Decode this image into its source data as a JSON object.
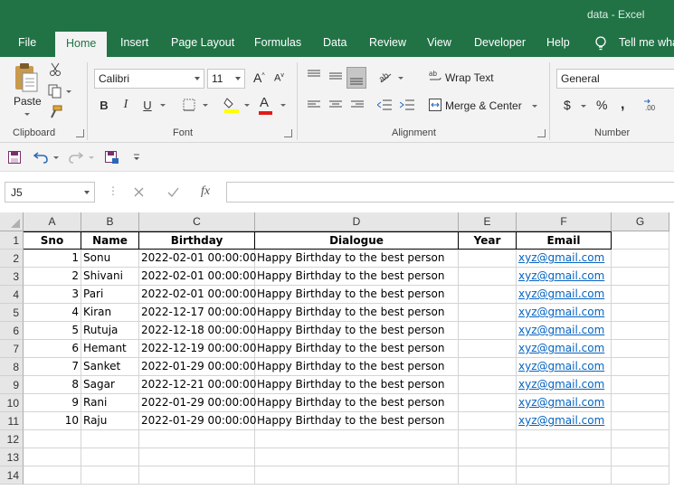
{
  "title": "data  -  Excel",
  "tabs": [
    "File",
    "Home",
    "Insert",
    "Page Layout",
    "Formulas",
    "Data",
    "Review",
    "View",
    "Developer",
    "Help",
    "Tell me wha"
  ],
  "active_tab": "Home",
  "ribbon": {
    "clipboard": {
      "paste_label": "Paste",
      "group_label": "Clipboard"
    },
    "font": {
      "name": "Calibri",
      "size": "11",
      "bold": "B",
      "italic": "I",
      "underline": "U",
      "color_glyph": "A",
      "group_label": "Font"
    },
    "alignment": {
      "wrap_text": "Wrap Text",
      "merge_center": "Merge & Center",
      "group_label": "Alignment"
    },
    "number": {
      "format": "General",
      "currency": "$",
      "percent": "%",
      "group_label": "Number"
    }
  },
  "formula_bar": {
    "name_box": "J5",
    "fx": "fx",
    "formula": ""
  },
  "sheet": {
    "columns": [
      "A",
      "B",
      "C",
      "D",
      "E",
      "F",
      "G"
    ],
    "row_numbers": [
      "1",
      "2",
      "3",
      "4",
      "5",
      "6",
      "7",
      "8",
      "9",
      "10",
      "11",
      "12",
      "13",
      "14"
    ],
    "headers": [
      "Sno",
      "Name",
      "Birthday",
      "Dialogue",
      "Year",
      "Email"
    ],
    "rows": [
      [
        "1",
        "Sonu",
        "2022-02-01 00:00:00",
        "Happy Birthday to the best person",
        "",
        "xyz@gmail.com"
      ],
      [
        "2",
        "Shivani",
        "2022-02-01 00:00:00",
        "Happy Birthday to the best person",
        "",
        "xyz@gmail.com"
      ],
      [
        "3",
        "Pari",
        "2022-02-01 00:00:00",
        "Happy Birthday to the best person",
        "",
        "xyz@gmail.com"
      ],
      [
        "4",
        "Kiran",
        "2022-12-17 00:00:00",
        "Happy Birthday to the best person",
        "",
        "xyz@gmail.com"
      ],
      [
        "5",
        "Rutuja",
        "2022-12-18 00:00:00",
        "Happy Birthday to the best person",
        "",
        "xyz@gmail.com"
      ],
      [
        "6",
        "Hemant",
        "2022-12-19 00:00:00",
        "Happy Birthday to the best person",
        "",
        "xyz@gmail.com"
      ],
      [
        "7",
        "Sanket",
        "2022-01-29 00:00:00",
        "Happy Birthday to the best person",
        "",
        "xyz@gmail.com"
      ],
      [
        "8",
        "Sagar",
        "2022-12-21 00:00:00",
        "Happy Birthday to the best person",
        "",
        "xyz@gmail.com"
      ],
      [
        "9",
        "Rani",
        "2022-01-29 00:00:00",
        "Happy Birthday to the best person",
        "",
        "xyz@gmail.com"
      ],
      [
        "10",
        "Raju",
        "2022-01-29 00:00:00",
        "Happy Birthday to the best person",
        "",
        "xyz@gmail.com"
      ]
    ]
  },
  "colors": {
    "brand": "#217346",
    "link": "#0563c1"
  }
}
